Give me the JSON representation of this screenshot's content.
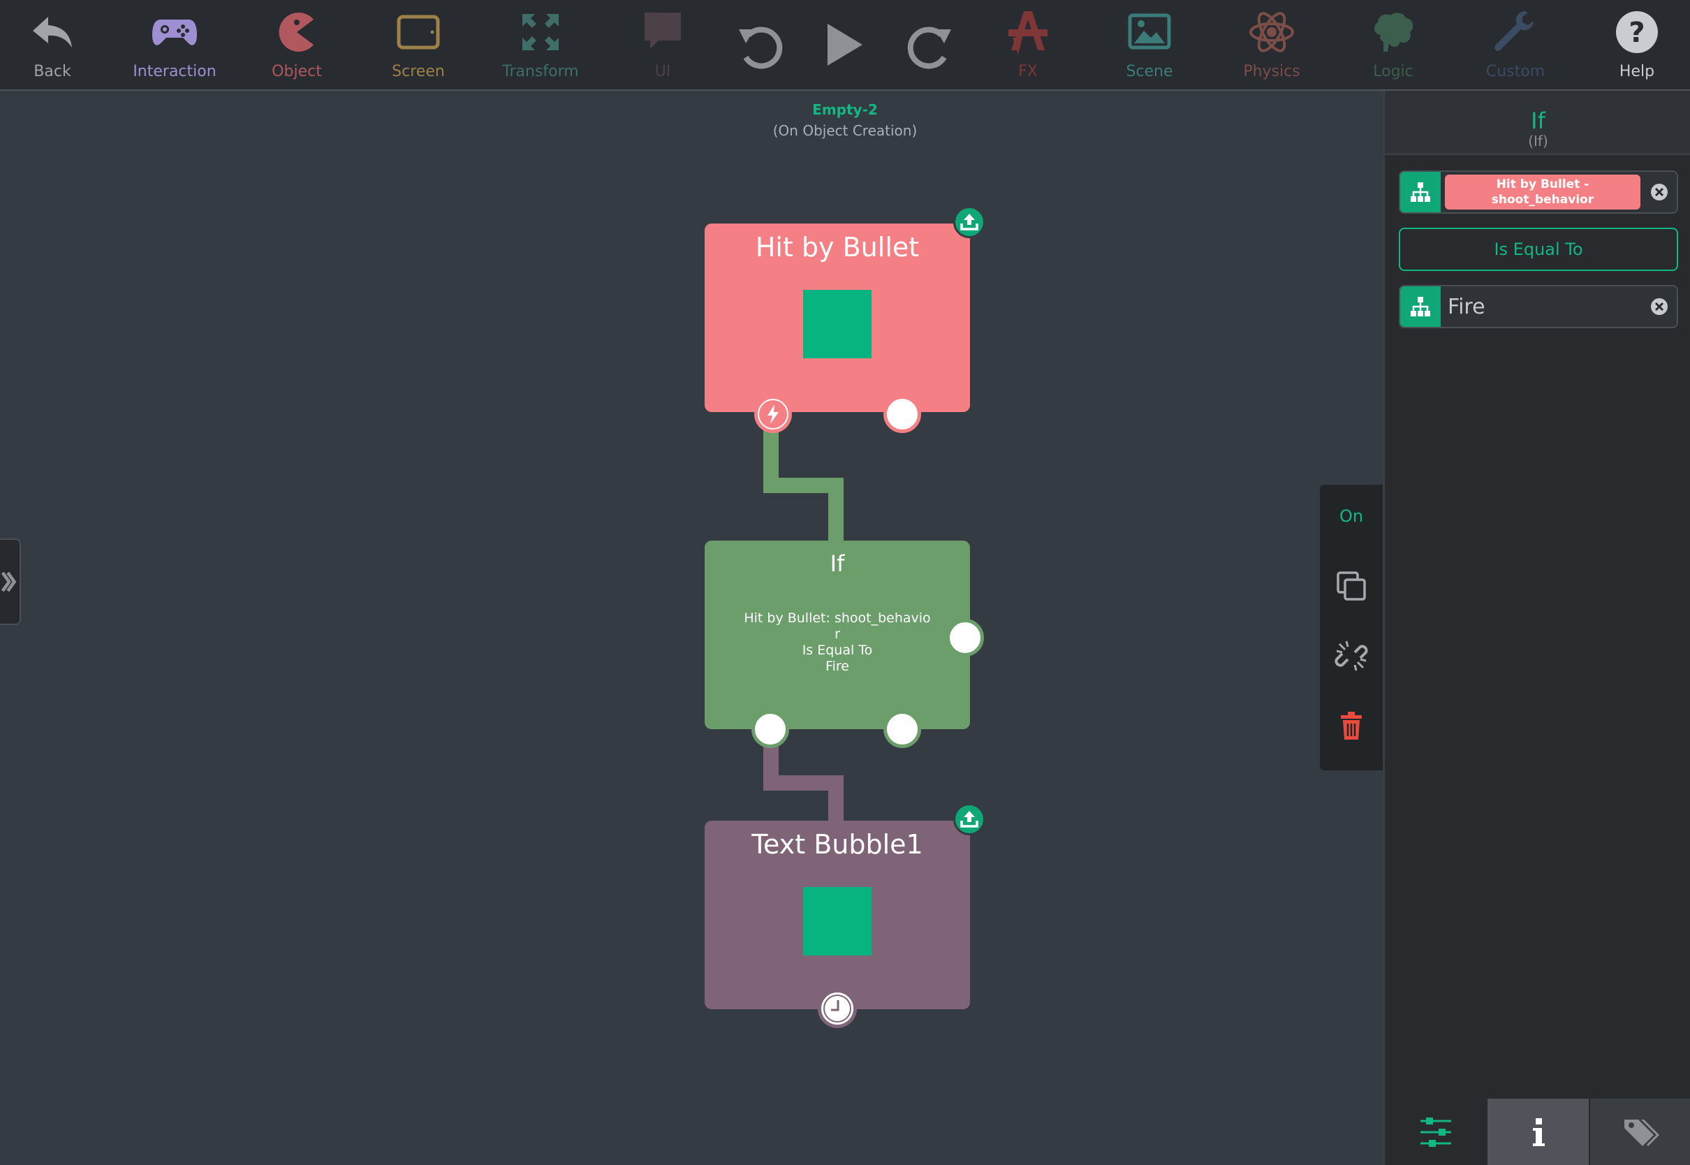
{
  "toolbar": {
    "items": [
      {
        "label": "Back",
        "icon": "undo-arrow-icon",
        "color": "#a0a4a8"
      },
      {
        "label": "Interaction",
        "icon": "gamepad-icon",
        "color": "#9d8fd1"
      },
      {
        "label": "Object",
        "icon": "pacman-icon",
        "color": "#b0585d"
      },
      {
        "label": "Screen",
        "icon": "tablet-icon",
        "color": "#9c8148"
      },
      {
        "label": "Transform",
        "icon": "expand-arrows-icon",
        "color": "#3f6e69"
      },
      {
        "label": "UI",
        "icon": "speech-bubble-icon",
        "color": "#4c4147"
      },
      {
        "label": "FX",
        "icon": "fx-brush-icon",
        "color": "#7e3637"
      },
      {
        "label": "Scene",
        "icon": "image-icon",
        "color": "#3b7c7a"
      },
      {
        "label": "Physics",
        "icon": "atom-icon",
        "color": "#7b4e48"
      },
      {
        "label": "Logic",
        "icon": "brain-icon",
        "color": "#3b5e4d"
      },
      {
        "label": "Custom",
        "icon": "wrench-icon",
        "color": "#3b4b61"
      },
      {
        "label": "Help",
        "icon": "help-circle-icon",
        "color": "#c9ccd0"
      }
    ]
  },
  "canvas": {
    "object_name": "Empty-2",
    "event": "(On Object Creation)"
  },
  "nodes": {
    "hit": {
      "title": "Hit by Bullet",
      "color": "#f47f84"
    },
    "if": {
      "title": "If",
      "lines": [
        "Hit by Bullet: shoot_behavio",
        "r",
        "Is Equal To",
        "Fire"
      ],
      "color": "#6b9e6b"
    },
    "text": {
      "title": "Text Bubble1",
      "color": "#7e6476"
    }
  },
  "context_menu": {
    "on_label": "On"
  },
  "panel": {
    "title": "If",
    "subtitle": "(If)",
    "param1": "Hit by Bullet - shoot_behavior",
    "operator": "Is Equal To",
    "param2": "Fire"
  }
}
